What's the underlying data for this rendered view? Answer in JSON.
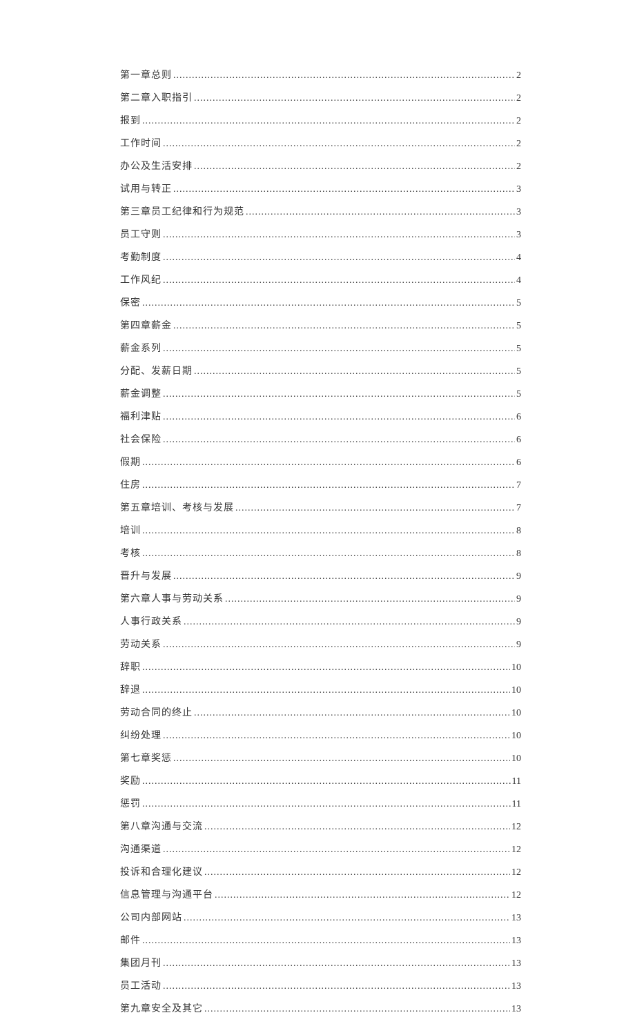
{
  "toc": [
    {
      "title": "第一章总则",
      "page": "2"
    },
    {
      "title": "第二章入职指引",
      "page": "2"
    },
    {
      "title": "报到",
      "page": "2"
    },
    {
      "title": "工作时间",
      "page": "2"
    },
    {
      "title": "办公及生活安排",
      "page": "2"
    },
    {
      "title": "试用与转正",
      "page": "3"
    },
    {
      "title": "第三章员工纪律和行为规范",
      "page": "3"
    },
    {
      "title": "员工守则",
      "page": "3"
    },
    {
      "title": "考勤制度",
      "page": "4"
    },
    {
      "title": "工作风纪",
      "page": "4"
    },
    {
      "title": "保密",
      "page": "5"
    },
    {
      "title": "第四章薪金",
      "page": "5"
    },
    {
      "title": "薪金系列",
      "page": "5"
    },
    {
      "title": "分配、发薪日期",
      "page": "5"
    },
    {
      "title": "薪金调整",
      "page": "5"
    },
    {
      "title": "福利津贴",
      "page": "6"
    },
    {
      "title": "社会保险",
      "page": "6"
    },
    {
      "title": "假期",
      "page": "6"
    },
    {
      "title": "住房",
      "page": "7"
    },
    {
      "title": "第五章培训、考核与发展",
      "page": "7"
    },
    {
      "title": "培训",
      "page": "8"
    },
    {
      "title": "考核",
      "page": "8"
    },
    {
      "title": "晋升与发展",
      "page": "9"
    },
    {
      "title": "第六章人事与劳动关系",
      "page": "9"
    },
    {
      "title": "人事行政关系",
      "page": "9"
    },
    {
      "title": "劳动关系",
      "page": "9"
    },
    {
      "title": "辞职",
      "page": "10"
    },
    {
      "title": "辞退",
      "page": "10"
    },
    {
      "title": "劳动合同的终止",
      "page": "10"
    },
    {
      "title": "纠纷处理",
      "page": "10"
    },
    {
      "title": "第七章奖惩",
      "page": "10"
    },
    {
      "title": "奖励",
      "page": "11"
    },
    {
      "title": "惩罚",
      "page": "11"
    },
    {
      "title": "第八章沟通与交流",
      "page": "12"
    },
    {
      "title": "沟通渠道",
      "page": "12"
    },
    {
      "title": "投诉和合理化建议",
      "page": "12"
    },
    {
      "title": "信息管理与沟通平台",
      "page": "12"
    },
    {
      "title": "公司内部网站",
      "page": "13"
    },
    {
      "title": "邮件",
      "page": "13"
    },
    {
      "title": "集团月刊",
      "page": "13"
    },
    {
      "title": "员工活动",
      "page": "13"
    },
    {
      "title": "第九章安全及其它",
      "page": "13"
    }
  ]
}
